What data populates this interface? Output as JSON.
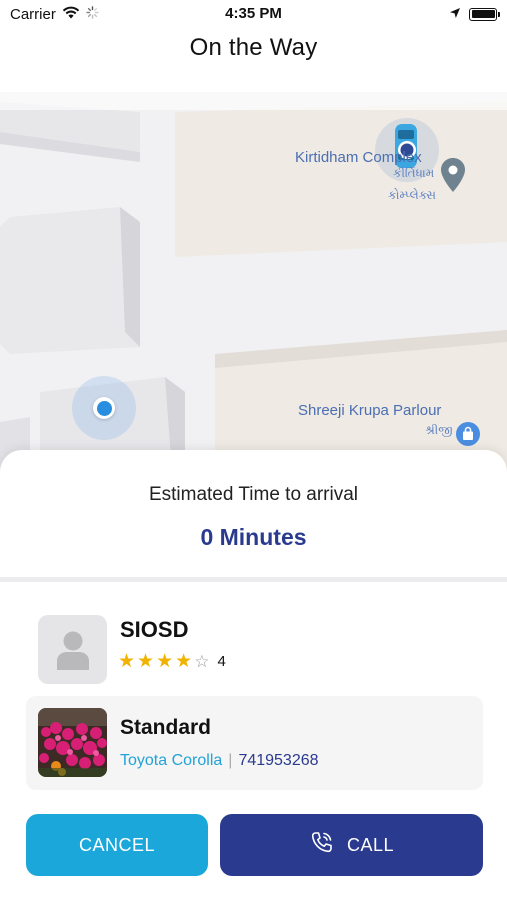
{
  "status_bar": {
    "carrier": "Carrier",
    "time": "4:35 PM"
  },
  "header": {
    "title": "On the Way"
  },
  "map": {
    "labels": {
      "kirtidham_en": "Kirtidham Complex",
      "kirtidham_gu_1": "કીર્તિધામ",
      "kirtidham_gu_2": "કોમ્પ્લેક્સ",
      "shreeji_en": "Shreeji Krupa Parlour",
      "shreeji_gu": "શ્રીજી"
    }
  },
  "eta": {
    "title": "Estimated Time to arrival",
    "value": "0 Minutes"
  },
  "driver": {
    "name": "SIOSD",
    "rating": "4",
    "stars_filled": 4,
    "stars_total": 5
  },
  "vehicle": {
    "type": "Standard",
    "model": "Toyota Corolla",
    "separator": "|",
    "number": "741953268"
  },
  "actions": {
    "cancel_label": "CANCEL",
    "call_label": "CALL"
  },
  "colors": {
    "accent_blue": "#1ba7da",
    "brand_navy": "#2a3a8f",
    "star": "#f0b400"
  }
}
